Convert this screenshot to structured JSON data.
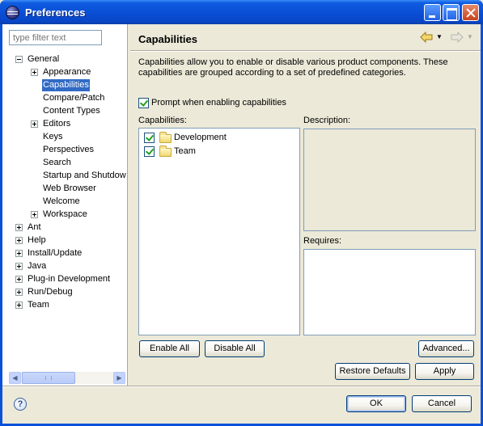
{
  "window": {
    "title": "Preferences"
  },
  "filter": {
    "placeholder": "type filter text"
  },
  "tree": {
    "general": "General",
    "appearance": "Appearance",
    "capabilities": "Capabilities",
    "compare_patch": "Compare/Patch",
    "content_types": "Content Types",
    "editors": "Editors",
    "keys": "Keys",
    "perspectives": "Perspectives",
    "search": "Search",
    "startup_shutdown": "Startup and Shutdow",
    "web_browser": "Web Browser",
    "welcome": "Welcome",
    "workspace": "Workspace",
    "ant": "Ant",
    "help": "Help",
    "install_update": "Install/Update",
    "java": "Java",
    "plugin_development": "Plug-in Development",
    "run_debug": "Run/Debug",
    "team": "Team"
  },
  "page": {
    "title": "Capabilities",
    "intro_line1": "Capabilities allow you to enable or disable various product components.  These",
    "intro_line2": "capabilities are grouped according to a set of predefined categories.",
    "prompt_label": "Prompt when enabling capabilities",
    "prompt_checked": true,
    "capabilities_label": "Capabilities:",
    "description_label": "Description:",
    "requires_label": "Requires:",
    "capabilities": [
      {
        "label": "Development",
        "checked": true
      },
      {
        "label": "Team",
        "checked": true
      }
    ]
  },
  "buttons": {
    "enable_all": "Enable All",
    "disable_all": "Disable All",
    "advanced": "Advanced...",
    "restore_defaults": "Restore Defaults",
    "apply": "Apply",
    "ok": "OK",
    "cancel": "Cancel"
  },
  "icons": {
    "back": "back-arrow-icon",
    "forward": "forward-arrow-icon",
    "help": "help-icon",
    "folder": "folder-icon"
  },
  "colors": {
    "titlebar": "#0a4fd6",
    "selection": "#316ac5",
    "window_bg": "#ece9d8",
    "check": "#21a121"
  }
}
